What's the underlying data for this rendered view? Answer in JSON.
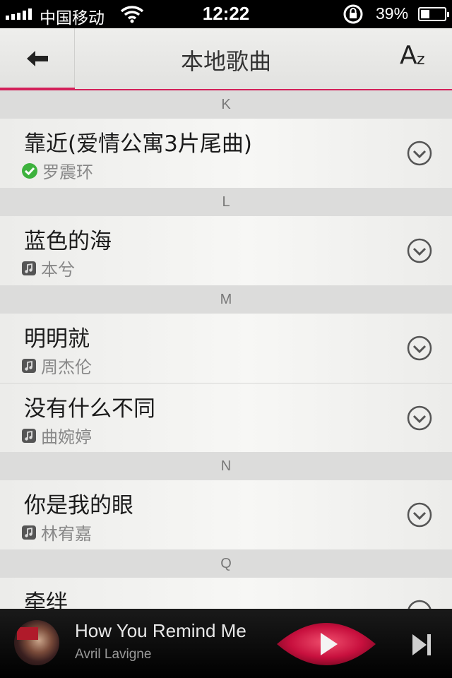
{
  "status_bar": {
    "carrier": "中国移动",
    "time": "12:22",
    "battery_text": "39%",
    "battery_level": 0.39,
    "signal_bars": 5
  },
  "nav": {
    "title": "本地歌曲",
    "back_icon": "arrow-left-icon",
    "sort_icon": "az-sort-icon",
    "sort_label_big": "A",
    "sort_label_small": "z"
  },
  "sections": [
    {
      "letter": "K",
      "songs": [
        {
          "title": "靠近(爱情公寓3片尾曲)",
          "artist": "罗震环",
          "status": "downloaded"
        }
      ]
    },
    {
      "letter": "L",
      "songs": [
        {
          "title": "蓝色的海",
          "artist": "本兮",
          "status": "local"
        }
      ]
    },
    {
      "letter": "M",
      "songs": [
        {
          "title": "明明就",
          "artist": "周杰伦",
          "status": "local"
        },
        {
          "title": "没有什么不同",
          "artist": "曲婉婷",
          "status": "local"
        }
      ]
    },
    {
      "letter": "N",
      "songs": [
        {
          "title": "你是我的眼",
          "artist": "林宥嘉",
          "status": "local"
        }
      ]
    },
    {
      "letter": "Q",
      "songs": [
        {
          "title": "牵绊",
          "artist": "",
          "status": "local"
        }
      ]
    }
  ],
  "player": {
    "title": "How You Remind Me",
    "artist": "Avril Lavigne",
    "play_icon": "play-icon",
    "next_icon": "skip-next-icon"
  },
  "colors": {
    "accent": "#d3205a",
    "downloaded": "#3db23d",
    "player_bg": "#000000"
  }
}
